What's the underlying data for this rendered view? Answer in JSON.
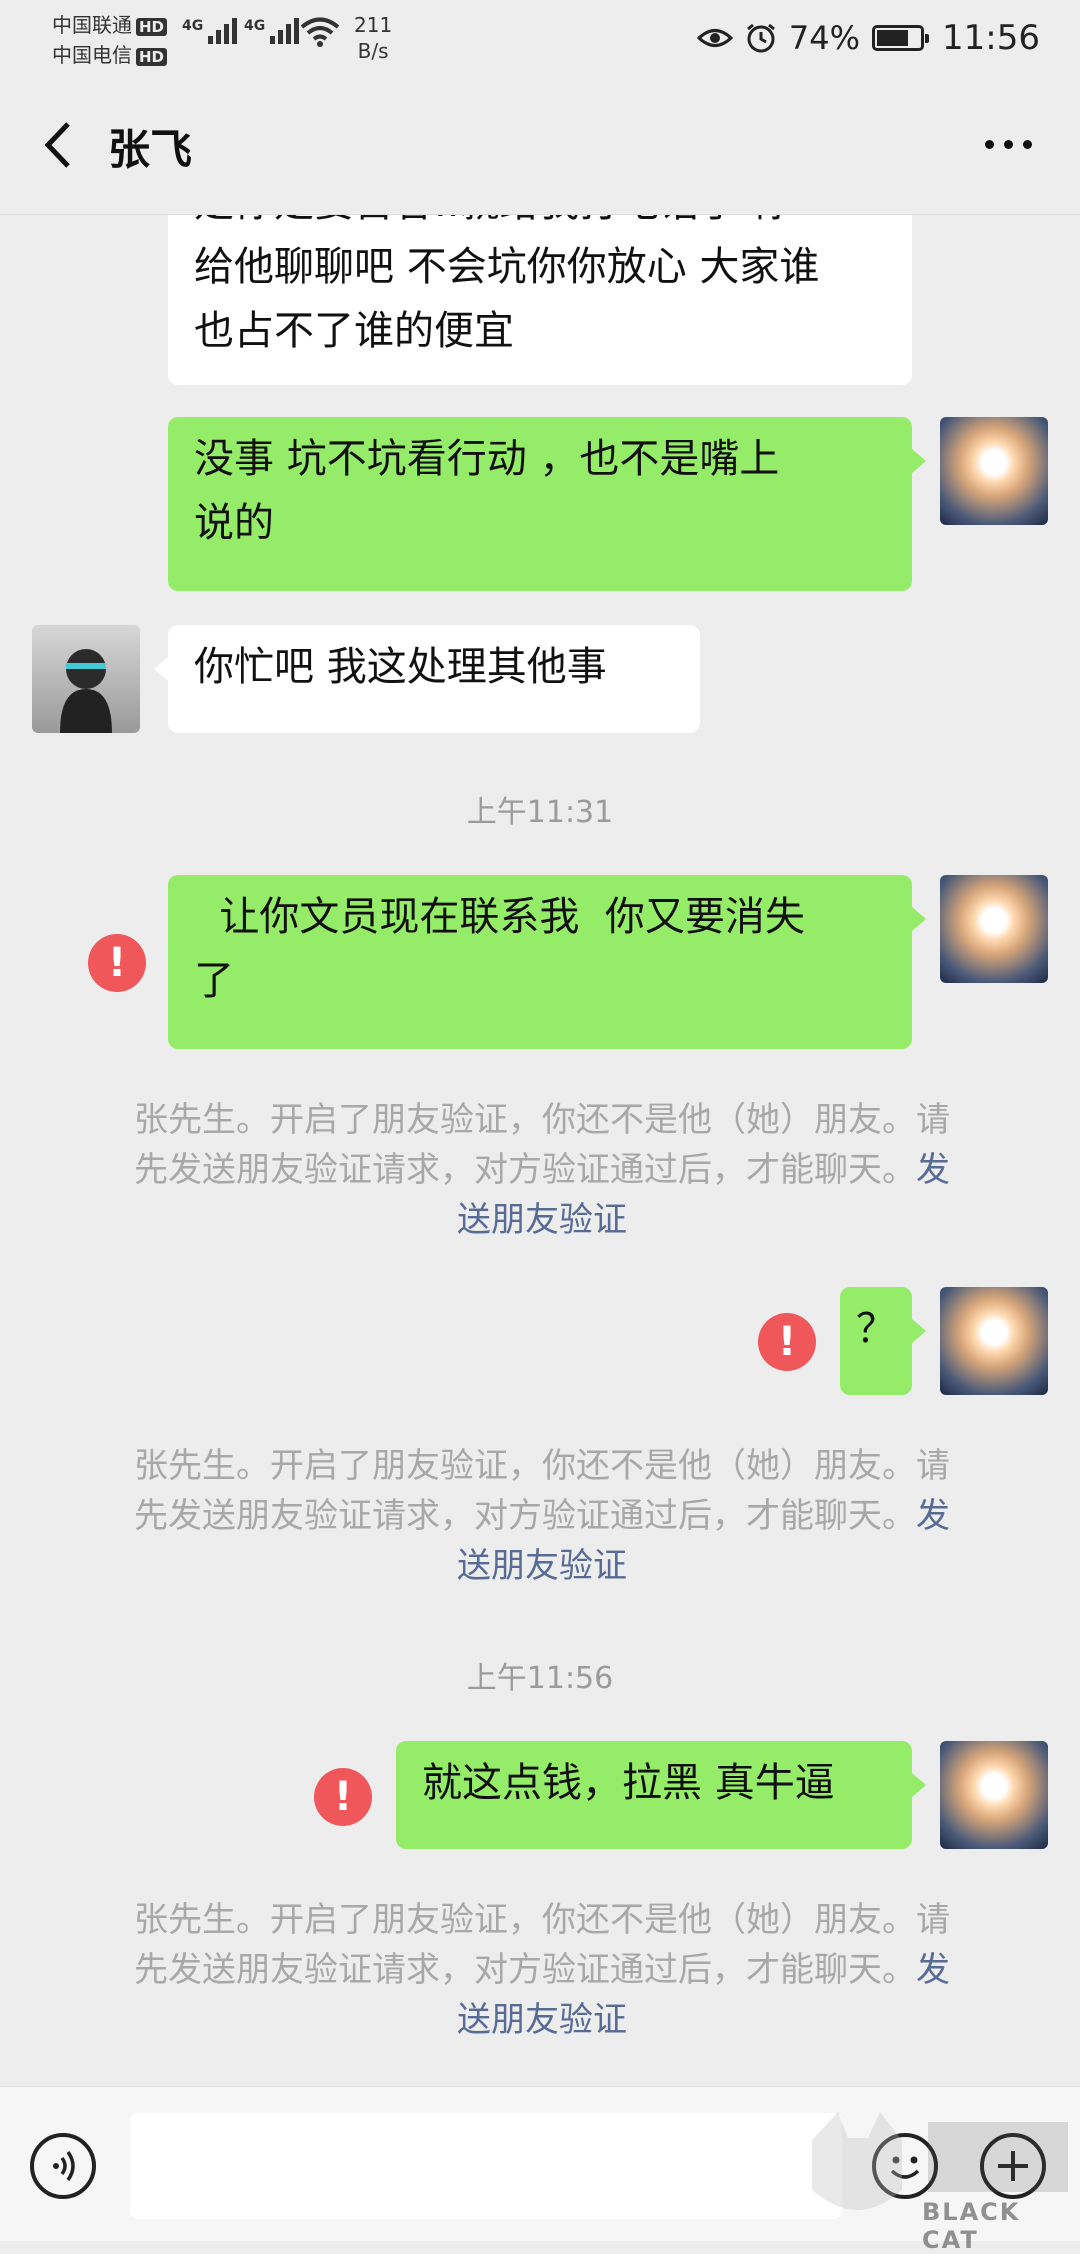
{
  "status_bar": {
    "carrier_1": "中国联通",
    "carrier_2": "中国电信",
    "hd_badge": "HD",
    "network_1": "4G",
    "network_2": "4G",
    "speed_value": "211",
    "speed_unit": "B/s",
    "battery_percent": "74%",
    "battery_level": 0.74,
    "time": "11:56"
  },
  "header": {
    "title": "张飞",
    "back_icon": "chevron-left-icon",
    "more_icon": "more-dots-icon"
  },
  "messages": [
    {
      "type": "incoming",
      "text_lines": [
        "是你是要首答..就给我打电话了 你",
        "给他聊聊吧 不会坑你你放心 大家谁",
        "也占不了谁的便宜"
      ]
    },
    {
      "type": "outgoing",
      "text_lines": [
        "没事   坑不坑看行动  ，也不是嘴上",
        "说的"
      ]
    },
    {
      "type": "incoming",
      "text_lines": [
        "你忙吧 我这处理其他事"
      ]
    },
    {
      "type": "timestamp",
      "text": "上午11:31"
    },
    {
      "type": "outgoing",
      "failed": true,
      "text_lines": [
        "  让你文员现在联系我  你又要消失",
        "了"
      ]
    },
    {
      "type": "system",
      "text": "张先生。开启了朋友验证，你还不是他（她）朋友。请先发送朋友验证请求，对方验证通过后，才能聊天。",
      "link": "发送朋友验证"
    },
    {
      "type": "outgoing",
      "failed": true,
      "text_lines": [
        "？"
      ]
    },
    {
      "type": "system",
      "text": "张先生。开启了朋友验证，你还不是他（她）朋友。请先发送朋友验证请求，对方验证通过后，才能聊天。",
      "link": "发送朋友验证"
    },
    {
      "type": "timestamp",
      "text": "上午11:56"
    },
    {
      "type": "outgoing",
      "failed": true,
      "text_lines": [
        "就这点钱，拉黑 真牛逼"
      ]
    },
    {
      "type": "system",
      "text": "张先生。开启了朋友验证，你还不是他（她）朋友。请先发送朋友验证请求，对方验证通过后，才能聊天。",
      "link": "发送朋友验证"
    }
  ],
  "system_msg": {
    "line1": "张先生。开启了朋友验证，你还不是他（她）朋友。请",
    "line2_text": "先发送朋友验证请求，对方验证通过后，才能聊天。",
    "line2_link": "发",
    "line3_link": "送朋友验证"
  },
  "error_mark": "!",
  "input_bar": {
    "voice_icon": "voice-icon",
    "emoji_icon": "emoji-icon",
    "plus_icon": "plus-icon"
  },
  "watermark": {
    "text": "BLACK CAT"
  }
}
